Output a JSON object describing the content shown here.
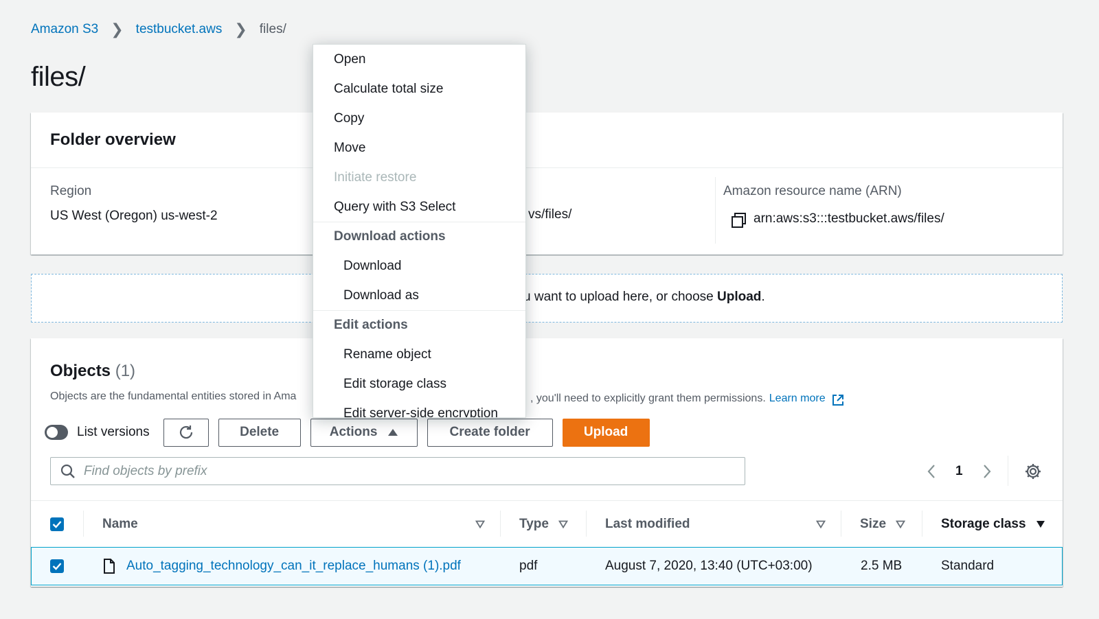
{
  "breadcrumb": {
    "root": "Amazon S3",
    "bucket": "testbucket.aws",
    "current": "files/"
  },
  "page": {
    "title": "files/"
  },
  "overview": {
    "title": "Folder overview",
    "region_label": "Region",
    "region_value": "US West (Oregon) us-west-2",
    "uri_value_partial": "vs/files/",
    "arn_label": "Amazon resource name (ARN)",
    "arn_value": "arn:aws:s3:::testbucket.aws/files/"
  },
  "dropzone": {
    "text_partial": "u want to upload here, or choose ",
    "upload_word": "Upload",
    "period": "."
  },
  "objects": {
    "title": "Objects",
    "count": "(1)",
    "description_start": "Objects are the fundamental entities stored in Ama",
    "description_end": ", you'll need to explicitly grant them permissions.",
    "learn_more": "Learn more",
    "list_versions_label": "List versions",
    "delete_label": "Delete",
    "actions_label": "Actions",
    "create_folder_label": "Create folder",
    "upload_label": "Upload",
    "search_placeholder": "Find objects by prefix",
    "page_number": "1"
  },
  "table": {
    "columns": [
      "Name",
      "Type",
      "Last modified",
      "Size",
      "Storage class"
    ],
    "rows": [
      {
        "name": "Auto_tagging_technology_can_it_replace_humans (1).pdf",
        "type": "pdf",
        "last_modified": "August 7, 2020, 13:40 (UTC+03:00)",
        "size": "2.5 MB",
        "storage_class": "Standard"
      }
    ]
  },
  "actions_menu": {
    "open": "Open",
    "calc_size": "Calculate total size",
    "copy": "Copy",
    "move": "Move",
    "initiate_restore": "Initiate restore",
    "query_select": "Query with S3 Select",
    "download_group": "Download actions",
    "download": "Download",
    "download_as": "Download as",
    "edit_group": "Edit actions",
    "rename": "Rename object",
    "edit_storage": "Edit storage class",
    "edit_encryption": "Edit server-side encryption"
  },
  "colors": {
    "link": "#0073bb",
    "upload": "#ec7211",
    "selected_row_bg": "#f1faff",
    "selected_row_border": "#00a1c9"
  }
}
